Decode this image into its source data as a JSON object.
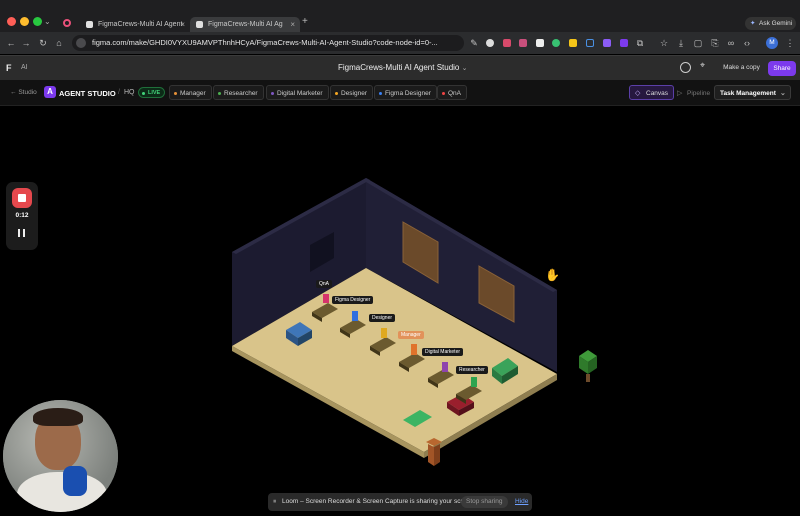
{
  "browser": {
    "tabs": [
      {
        "title": "FigmaCrews-Multi AI Agent"
      },
      {
        "title": "FigmaCrews-Multi AI Ag"
      }
    ],
    "new_tab": "+",
    "ask_gemini": "Ask Gemini",
    "url": "figma.com/make/GHDI0VYXU9AMVPThnhHCyA/FigmaCrews-Multi-AI-Agent-Studio?code-node-id=0-...",
    "profile": "M"
  },
  "figma": {
    "file_title": "FigmaCrews-Multi AI Agent Studio",
    "ai_label": "AI",
    "make_copy": "Make a copy",
    "share": "Share"
  },
  "app": {
    "back_label": "Studio",
    "logo_letter": "A",
    "title": "AGENT STUDIO",
    "separator": "/",
    "hq": "HQ",
    "live": "LIVE",
    "agents": [
      {
        "label": "Manager",
        "color": "#e69138"
      },
      {
        "label": "Researcher",
        "color": "#4caf50"
      },
      {
        "label": "Digital Marketer",
        "color": "#7e57c2"
      },
      {
        "label": "Designer",
        "color": "#f5a623"
      },
      {
        "label": "Figma Designer",
        "color": "#3b82f6"
      },
      {
        "label": "QnA",
        "color": "#ef4444"
      }
    ],
    "canvas": "Canvas",
    "pipeline": "Pipeline",
    "task_menu": "Task Management"
  },
  "scene": {
    "labels": {
      "qna": "QnA",
      "figma_designer": "Figma Designer",
      "designer": "Designer",
      "manager": "Manager",
      "digital_marketer": "Digital Marketer",
      "researcher": "Researcher"
    }
  },
  "recorder": {
    "time": "0:12"
  },
  "share_bar": {
    "message": "Loom – Screen Recorder & Screen Capture is sharing your screen.",
    "stop": "Stop sharing",
    "hide": "Hide"
  }
}
